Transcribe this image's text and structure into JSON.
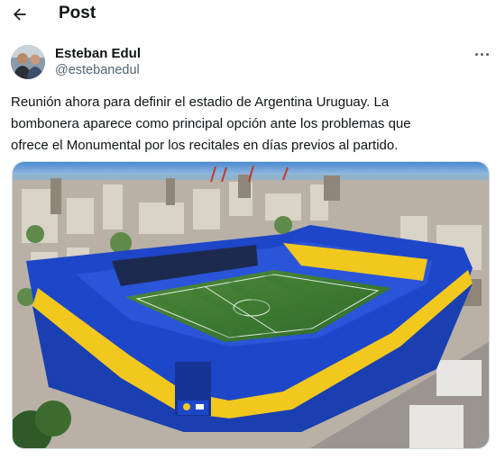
{
  "header": {
    "title": "Post",
    "back_icon": "back-arrow-icon"
  },
  "author": {
    "name": "Esteban Edul",
    "handle": "@estebanedul"
  },
  "post": {
    "lines": [
      "Reunión ahora para definir el estadio de Argentina Uruguay. La",
      "bombonera aparece como principal opción ante los problemas que",
      "ofrece el Monumental por los recitales en días previos al partido."
    ]
  },
  "media": {
    "description_icon": "stadium-photo"
  },
  "colors": {
    "text": "#0f1419",
    "secondary": "#536471",
    "stadium_blue": "#1e46c8",
    "stadium_yellow": "#f2c81e"
  }
}
